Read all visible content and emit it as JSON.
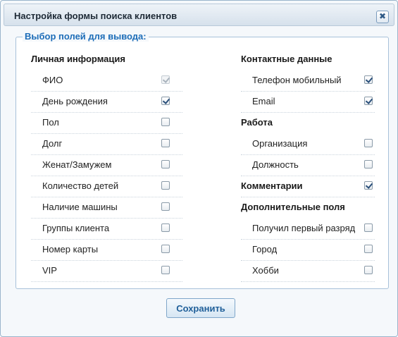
{
  "dialog": {
    "title": "Настройка формы поиска клиентов",
    "close_icon": "close-icon",
    "close_glyph": "✖"
  },
  "fieldset": {
    "legend": "Выбор полей для вывода:"
  },
  "left": {
    "section_personal": "Личная информация",
    "items": [
      {
        "label": "ФИО",
        "checked": true,
        "disabled": true
      },
      {
        "label": "День рождения",
        "checked": true,
        "disabled": false
      },
      {
        "label": "Пол",
        "checked": false,
        "disabled": false
      },
      {
        "label": "Долг",
        "checked": false,
        "disabled": false
      },
      {
        "label": "Женат/Замужем",
        "checked": false,
        "disabled": false
      },
      {
        "label": "Количество детей",
        "checked": false,
        "disabled": false
      },
      {
        "label": "Наличие машины",
        "checked": false,
        "disabled": false
      },
      {
        "label": "Группы клиента",
        "checked": false,
        "disabled": false
      },
      {
        "label": "Номер карты",
        "checked": false,
        "disabled": false
      },
      {
        "label": "VIP",
        "checked": false,
        "disabled": false
      }
    ]
  },
  "right": {
    "section_contacts": "Контактные данные",
    "contacts": [
      {
        "label": "Телефон мобильный",
        "checked": true
      },
      {
        "label": "Email",
        "checked": true
      }
    ],
    "section_work": "Работа",
    "work": [
      {
        "label": "Организация",
        "checked": false
      },
      {
        "label": "Должность",
        "checked": false
      }
    ],
    "section_comments": "Комментарии",
    "comments_checked": true,
    "section_extra": "Дополнительные поля",
    "extra": [
      {
        "label": "Получил первый разряд",
        "checked": false
      },
      {
        "label": "Город",
        "checked": false
      },
      {
        "label": "Хобби",
        "checked": false
      }
    ]
  },
  "footer": {
    "save_label": "Сохранить"
  },
  "colors": {
    "accent": "#1d6db8",
    "border": "#a7c1d9"
  }
}
